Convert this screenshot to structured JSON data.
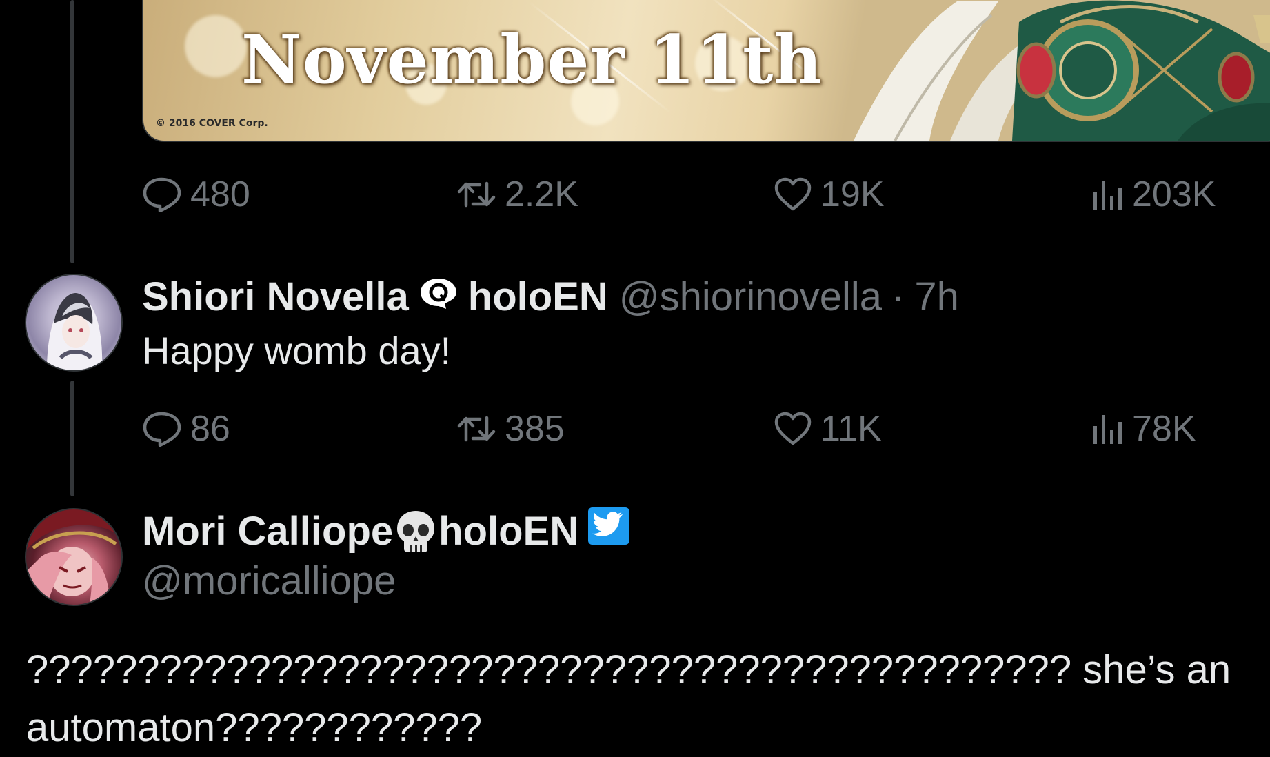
{
  "media": {
    "headline": "November 11th",
    "copyright": "© 2016 COVER Corp."
  },
  "top_tweet_actions": {
    "replies": "480",
    "retweets": "2.2K",
    "likes": "19K",
    "views": "203K"
  },
  "reply_tweet": {
    "display_name": "Shiori Novella",
    "affiliation": "holoEN",
    "handle": "@shiorinovella",
    "separator": "·",
    "time": "7h",
    "text": "Happy womb day!",
    "actions": {
      "replies": "86",
      "retweets": "385",
      "likes": "11K",
      "views": "78K"
    }
  },
  "main_tweet": {
    "display_name": "Mori Calliope",
    "affiliation": "holoEN",
    "handle": "@moricalliope",
    "text": "??????????????????????????????????????????????? she’s an automaton????????????"
  },
  "colors": {
    "background": "#000000",
    "text_primary": "#e7e9ea",
    "text_secondary": "#71767b",
    "thread_line": "#333639",
    "twitter_blue": "#1d9bf0"
  },
  "icons": {
    "reply": "speech-bubble-icon",
    "retweet": "retweet-arrows-icon",
    "like": "heart-outline-icon",
    "views": "bar-chart-icon",
    "shiori_badge": "magnifier-bubble-icon",
    "mori_badge": "skull-icon",
    "twitter_badge": "twitter-bird-icon"
  }
}
